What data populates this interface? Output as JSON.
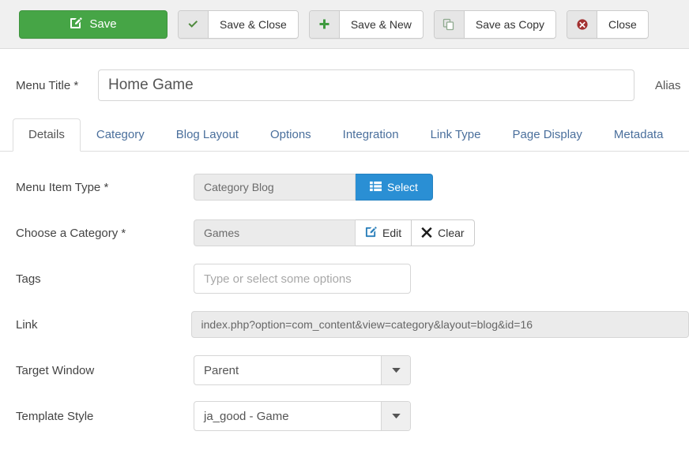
{
  "toolbar": {
    "buttons": [
      {
        "label": "Save",
        "icon": "pencil-square-icon",
        "style": "primary"
      },
      {
        "label": "Save & Close",
        "icon": "check-icon",
        "style": "default"
      },
      {
        "label": "Save & New",
        "icon": "plus-icon",
        "style": "default"
      },
      {
        "label": "Save as Copy",
        "icon": "copy-icon",
        "style": "default"
      },
      {
        "label": "Close",
        "icon": "remove-circle-icon",
        "style": "default"
      }
    ]
  },
  "title_row": {
    "label": "Menu Title *",
    "value": "Home Game",
    "placeholder": "",
    "alias_label": "Alias"
  },
  "tabs": [
    {
      "label": "Details",
      "active": true
    },
    {
      "label": "Category",
      "active": false
    },
    {
      "label": "Blog Layout",
      "active": false
    },
    {
      "label": "Options",
      "active": false
    },
    {
      "label": "Integration",
      "active": false
    },
    {
      "label": "Link Type",
      "active": false
    },
    {
      "label": "Page Display",
      "active": false
    },
    {
      "label": "Metadata",
      "active": false
    }
  ],
  "form": {
    "menu_item_type": {
      "label": "Menu Item Type *",
      "value": "Category Blog",
      "button_label": "Select",
      "button_icon": "list-icon"
    },
    "choose_category": {
      "label": "Choose a Category *",
      "value": "Games",
      "edit_label": "Edit",
      "edit_icon": "pencil-square-icon",
      "clear_label": "Clear",
      "clear_icon": "times-icon"
    },
    "tags": {
      "label": "Tags",
      "value": "",
      "placeholder": "Type or select some options"
    },
    "link": {
      "label": "Link",
      "value": "index.php?option=com_content&view=category&layout=blog&id=16"
    },
    "target_window": {
      "label": "Target Window",
      "value": "Parent",
      "arrow_icon": "caret-down-icon"
    },
    "template_style": {
      "label": "Template Style",
      "value": "ja_good - Game",
      "arrow_icon": "caret-down-icon"
    }
  },
  "colors": {
    "save_green": "#46a546",
    "select_blue": "#2a8fd4",
    "close_red": "#a23030",
    "tab_link": "#4a6f9c",
    "toolbar_bg": "#f0f0f0"
  }
}
